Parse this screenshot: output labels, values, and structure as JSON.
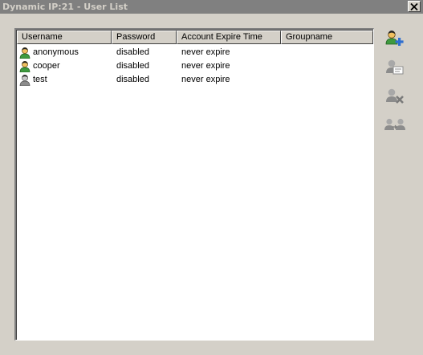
{
  "window": {
    "title": "Dynamic IP:21 - User List",
    "close_label": "✕"
  },
  "table": {
    "columns": [
      "Username",
      "Password",
      "Account Expire Time",
      "Groupname"
    ],
    "rows": [
      {
        "username": "anonymous",
        "password": "disabled",
        "expire": "never expire",
        "group": "",
        "icon": "user-icon"
      },
      {
        "username": "cooper",
        "password": "disabled",
        "expire": "never expire",
        "group": "",
        "icon": "user-icon"
      },
      {
        "username": "test",
        "password": "disabled",
        "expire": "never expire",
        "group": "",
        "icon": "user-disabled-icon"
      }
    ]
  },
  "toolbar": {
    "buttons": [
      {
        "name": "add-user-button",
        "icon": "add-user-icon",
        "enabled": true
      },
      {
        "name": "edit-user-button",
        "icon": "edit-user-icon",
        "enabled": false
      },
      {
        "name": "delete-user-button",
        "icon": "delete-user-icon",
        "enabled": false
      },
      {
        "name": "copy-user-button",
        "icon": "copy-user-icon",
        "enabled": false
      }
    ]
  },
  "colors": {
    "window_bg": "#d4d0c8",
    "titlebar_bg": "#808080",
    "accent_blue": "#2f6fd0",
    "user_body": "#3f9a3f",
    "user_face": "#f0c060",
    "disabled_gray": "#8c8c8c"
  }
}
